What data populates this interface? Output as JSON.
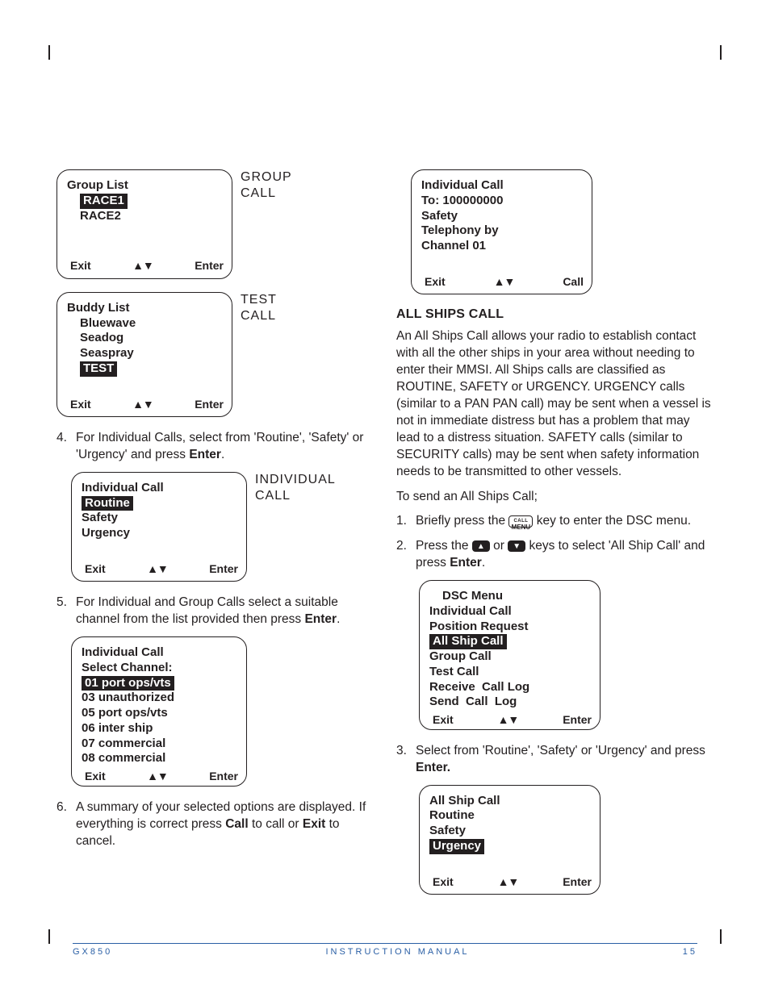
{
  "footer": {
    "model": "GX850",
    "title": "INSTRUCTION MANUAL",
    "page": "15"
  },
  "soft": {
    "exit": "Exit",
    "enter": "Enter",
    "call": "Call",
    "arrows": "▲▼"
  },
  "left": {
    "lcd1": {
      "sideLabel": "GROUP\nCALL",
      "title": "Group List",
      "items": [
        "RACE1",
        "RACE2"
      ],
      "hl": 0
    },
    "lcd2": {
      "sideLabel": "TEST\nCALL",
      "title": "Buddy List",
      "items": [
        "Bluewave",
        "Seadog",
        "Seaspray",
        "TEST"
      ],
      "hl": 3
    },
    "step4": "For Individual Calls, select from 'Routine', 'Safety' or 'Urgency' and press ",
    "step4b": "Enter",
    "lcd3": {
      "sideLabel": "INDIVIDUAL\nCALL",
      "title": "Individual Call",
      "items": [
        "Routine",
        "Safety",
        "Urgency"
      ],
      "hl": 0
    },
    "step5a": "For Individual and Group Calls select a suitable channel from the list provided then press ",
    "step5b": "Enter",
    "lcd4": {
      "title": "Individual Call",
      "sub": "Select Channel:",
      "items": [
        "01 port ops/vts",
        "03 unauthorized",
        "05 port ops/vts",
        "06 inter ship",
        "07 commercial",
        "08 commercial"
      ],
      "hl": 0
    },
    "step6a": "A summary of your selected options are displayed. If everything is correct press ",
    "step6b": "Call",
    "step6c": " to call or ",
    "step6d": "Exit",
    "step6e": " to cancel."
  },
  "right": {
    "lcd1": {
      "lines": [
        "Individual Call",
        "To: 100000000",
        "Safety",
        "Telephony by",
        "Channel 01"
      ]
    },
    "heading": "ALL SHIPS CALL",
    "para": "An All Ships Call allows your radio to establish contact with all the other ships in your area without needing to enter their MMSI. All Ships calls are classified as ROUTINE, SAFETY or URGENCY. URGENCY calls (similar to a PAN PAN call) may be sent when a vessel is not in immediate distress but has a problem that may lead to a distress situation. SAFETY calls (similar to SECURITY calls) may be sent when safety information needs to be transmitted to other vessels.",
    "lead": "To send an All Ships Call;",
    "step1a": "Briefly press the ",
    "step1b": " key to enter the DSC menu.",
    "keyMenu": {
      "top": "CALL",
      "bot": "MENU"
    },
    "step2a": "Press the ",
    "step2b": " or ",
    "step2c": " keys to select 'All Ship Call' and press ",
    "step2d": "Enter",
    "triUp": "▲",
    "triDown": "▼",
    "lcd2": {
      "title": "DSC Menu",
      "items": [
        "Individual Call",
        "Position Request",
        "All Ship Call",
        "Group Call",
        "Test Call",
        "Receive  Call Log",
        "Send  Call  Log"
      ],
      "hl": 2
    },
    "step3a": "Select from 'Routine', 'Safety' or 'Urgency' and press ",
    "step3b": "Enter.",
    "lcd3": {
      "title": "All Ship Call",
      "items": [
        "Routine",
        "Safety",
        "Urgency"
      ],
      "hl": 2
    }
  }
}
